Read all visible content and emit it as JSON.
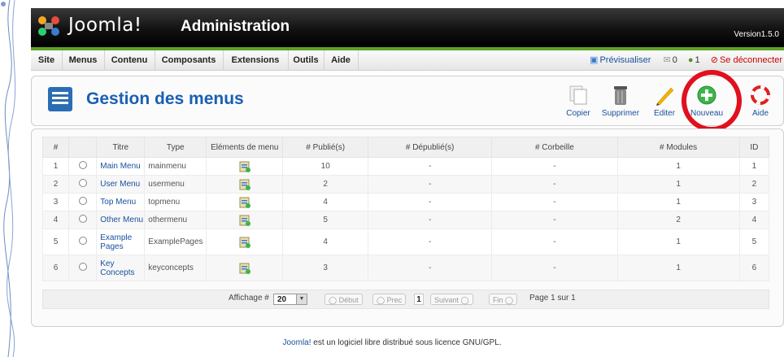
{
  "header": {
    "logo_text": "Joomla!",
    "admin_title": "Administration",
    "version": "Version1.5.0"
  },
  "menubar": {
    "items": [
      "Site",
      "Menus",
      "Contenu",
      "Composants",
      "Extensions",
      "Outils",
      "Aide"
    ],
    "preview": "Prévisualiser",
    "messages_count": "0",
    "users_count": "1",
    "logout": "Se déconnecter"
  },
  "page": {
    "title": "Gestion des menus"
  },
  "toolbar": {
    "copy": "Copier",
    "delete": "Supprimer",
    "edit": "Editer",
    "new": "Nouveau",
    "help": "Aide"
  },
  "table": {
    "headers": [
      "#",
      "",
      "Titre",
      "Type",
      "Eléments de menu",
      "# Publié(s)",
      "# Dépublié(s)",
      "# Corbeille",
      "# Modules",
      "ID"
    ],
    "rows": [
      {
        "num": "1",
        "title": "Main Menu",
        "type": "mainmenu",
        "published": "10",
        "unpublished": "-",
        "trash": "-",
        "modules": "1",
        "id": "1"
      },
      {
        "num": "2",
        "title": "User Menu",
        "type": "usermenu",
        "published": "2",
        "unpublished": "-",
        "trash": "-",
        "modules": "1",
        "id": "2"
      },
      {
        "num": "3",
        "title": "Top Menu",
        "type": "topmenu",
        "published": "4",
        "unpublished": "-",
        "trash": "-",
        "modules": "1",
        "id": "3"
      },
      {
        "num": "4",
        "title": "Other Menu",
        "type": "othermenu",
        "published": "5",
        "unpublished": "-",
        "trash": "-",
        "modules": "2",
        "id": "4"
      },
      {
        "num": "5",
        "title": "Example Pages",
        "type": "ExamplePages",
        "published": "4",
        "unpublished": "-",
        "trash": "-",
        "modules": "1",
        "id": "5"
      },
      {
        "num": "6",
        "title": "Key Concepts",
        "type": "keyconcepts",
        "published": "3",
        "unpublished": "-",
        "trash": "-",
        "modules": "1",
        "id": "6"
      }
    ]
  },
  "pagination": {
    "display_label": "Affichage #",
    "display_value": "20",
    "start": "Début",
    "prev": "Prec",
    "page": "1",
    "next": "Suivant",
    "end": "Fin",
    "page_info": "Page 1 sur 1"
  },
  "footer": {
    "link": "Joomla!",
    "text": " est un logiciel libre distribué sous licence GNU/GPL."
  },
  "colors": {
    "accent_green": "#5fa127",
    "title_blue": "#1a5fb4",
    "highlight_red": "#e0101e"
  }
}
